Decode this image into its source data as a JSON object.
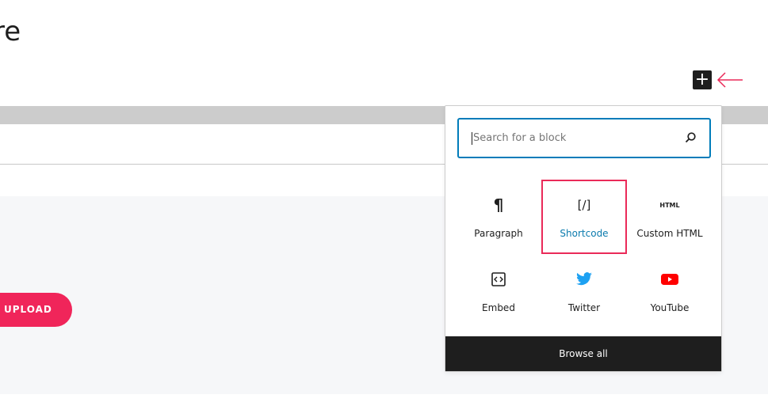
{
  "page": {
    "title_fragment": "re",
    "upload_label": "UPLOAD"
  },
  "inserter": {
    "search_placeholder": "Search for a block",
    "blocks": [
      {
        "label": "Paragraph",
        "icon": "paragraph-icon"
      },
      {
        "label": "Shortcode",
        "icon": "shortcode-icon",
        "icon_text": "[/]",
        "highlighted": true
      },
      {
        "label": "Custom HTML",
        "icon": "html-icon",
        "icon_text": "HTML"
      },
      {
        "label": "Embed",
        "icon": "embed-icon"
      },
      {
        "label": "Twitter",
        "icon": "twitter-icon"
      },
      {
        "label": "YouTube",
        "icon": "youtube-icon"
      }
    ],
    "browse_all": "Browse all"
  },
  "colors": {
    "accent": "#007cba",
    "highlight": "#ea2a59",
    "upload": "#f0255a",
    "twitter": "#1da1f2",
    "youtube": "#ff0000"
  }
}
